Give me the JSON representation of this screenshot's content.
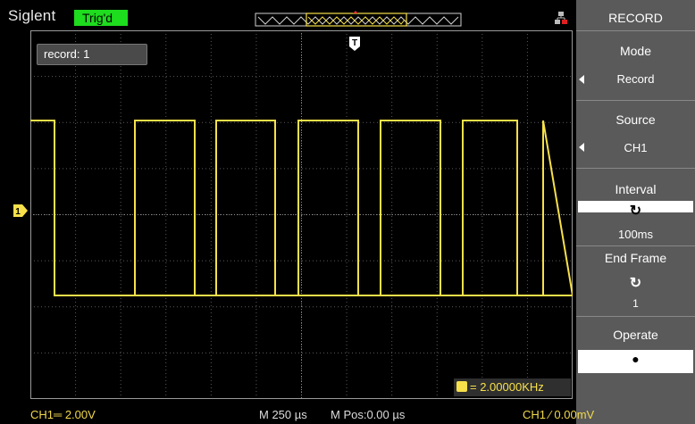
{
  "header": {
    "brand": "Siglent",
    "trigger_status": "Trig'd",
    "trigger_marker": "T"
  },
  "display": {
    "record_label": "record: 1",
    "channel_marker": "1",
    "frequency_readout": "= 2.00000KHz",
    "waveform_color": "#f7e04a"
  },
  "menu": {
    "title": "RECORD",
    "mode_label": "Mode",
    "mode_value": "Record",
    "source_label": "Source",
    "source_value": "CH1",
    "interval_label": "Interval",
    "interval_value": "100ms",
    "end_frame_label": "End Frame",
    "end_frame_value": "1",
    "operate_label": "Operate",
    "operate_value": "●"
  },
  "footer": {
    "ch1_scale": "CH1═ 2.00V",
    "timebase": "M 250 µs",
    "mpos": "M Pos:0.00 µs",
    "trigger_level": "CH1 ⁄ 0.00mV"
  },
  "colors": {
    "trace": "#f7e04a",
    "trig_badge": "#1edc1e",
    "menu_bg": "#5a5a5a"
  }
}
